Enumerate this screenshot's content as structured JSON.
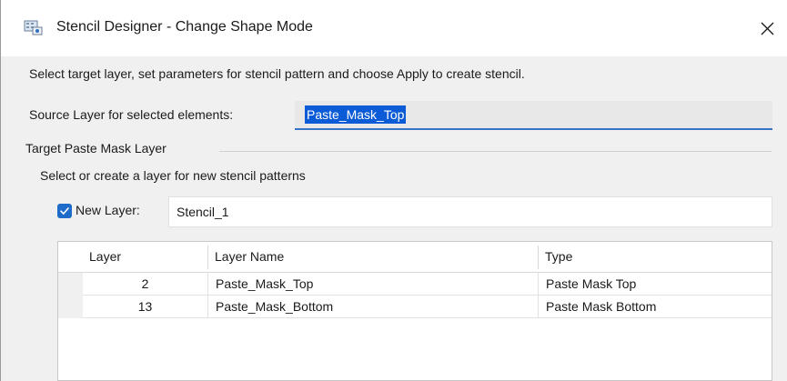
{
  "window": {
    "title": "Stencil Designer - Change Shape Mode"
  },
  "instruction": "Select target layer, set parameters for stencil pattern and choose Apply to create stencil.",
  "source": {
    "label": "Source Layer for selected elements:",
    "value": "Paste_Mask_Top"
  },
  "target_group": {
    "title": "Target Paste Mask Layer",
    "subtitle": "Select or create a layer for new stencil patterns",
    "new_layer": {
      "checked": true,
      "label": "New Layer:",
      "value": "Stencil_1"
    }
  },
  "layer_table": {
    "columns": [
      "Layer",
      "Layer Name",
      "Type"
    ],
    "rows": [
      {
        "layer": "2",
        "name": "Paste_Mask_Top",
        "type": "Paste Mask Top"
      },
      {
        "layer": "13",
        "name": "Paste_Mask_Bottom",
        "type": "Paste Mask Bottom"
      }
    ]
  },
  "colors": {
    "accent": "#1f6bc9",
    "selection": "#0b5bd6",
    "focus_underline": "#3673c7"
  },
  "icons": {
    "title": "stencil-designer-icon",
    "close": "close-icon",
    "check": "checkmark-icon"
  }
}
